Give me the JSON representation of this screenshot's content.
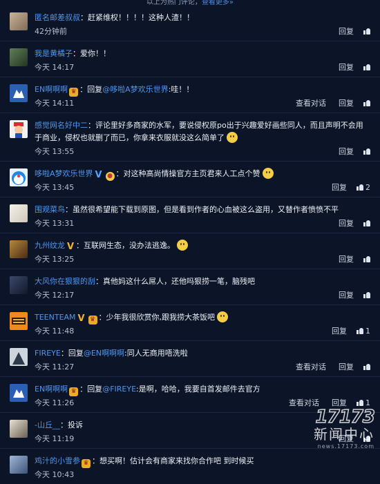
{
  "top_note": {
    "prefix": "以上为热门评论，",
    "link": "查看更多»"
  },
  "actions": {
    "reply": "回复",
    "view_conversation": "查看对话"
  },
  "comments": [
    {
      "user": "匿名邮差叔叔",
      "sep": "：",
      "text": "赶紧维权！！！！这种人渣！！",
      "time": "42分钟前",
      "likes": "",
      "conv": false
    },
    {
      "user": "我是黄橘子",
      "sep": "：",
      "text": "爱你！！",
      "time": "今天 14:17",
      "likes": "",
      "conv": false
    },
    {
      "user": "EN啊啊啊",
      "sep": "：",
      "reply_prefix": "回复",
      "reply_to": "@哆啦A梦欢乐世界",
      "text": ":哇！！",
      "time": "今天 14:11",
      "likes": "",
      "conv": true
    },
    {
      "user": "感觉网名好中二",
      "sep": "：",
      "text": "评论里好多商家的水军，要说侵权原po出于兴趣爱好画些同人，而且声明不会用于商业，侵权也就删了而已，你拿来衣服就没这么简单了",
      "time": "今天 13:55",
      "likes": "",
      "conv": false
    },
    {
      "user": "哆啦A梦欢乐世界",
      "sep": "：",
      "text": "对这种高尚情操官方主页君来人工点个赞",
      "time": "今天 13:45",
      "likes": "2",
      "conv": false
    },
    {
      "user": "围观菜鸟",
      "sep": "：",
      "text": "虽然很希望能下载到原图，但是看到作者的心血被这么盗用，又替作者愤愤不平",
      "time": "今天 13:31",
      "likes": "",
      "conv": false
    },
    {
      "user": "九州纹龙",
      "sep": "：",
      "text": "互联网生态，没办法逃逸。",
      "time": "今天 13:25",
      "likes": "",
      "conv": false
    },
    {
      "user": "大风你在狠狠的刮",
      "sep": "：",
      "text": "真他妈这什么屌人，还他吗狠捞一笔，脑残吧",
      "time": "今天 12:17",
      "likes": "",
      "conv": false
    },
    {
      "user": "TEENTEAM",
      "sep": "：",
      "text": "少年我很欣赏你,跟我捞大茶饭吧",
      "time": "今天 11:48",
      "likes": "1",
      "conv": false
    },
    {
      "user": "FIREYE",
      "sep": "：",
      "reply_prefix": "回复",
      "reply_to": "@EN啊啊啊",
      "text": ":同人无商用唔洗啦",
      "time": "今天 11:27",
      "likes": "",
      "conv": true
    },
    {
      "user": "EN啊啊啊",
      "sep": "：",
      "reply_prefix": "回复",
      "reply_to": "@FIREYE",
      "text": ":是啊，哈哈，我要自首发邮件去官方",
      "time": "今天 11:26",
      "likes": "1",
      "conv": true
    },
    {
      "user": "-山丘__",
      "sep": "：",
      "text": "投诉",
      "time": "今天 11:19",
      "likes": "",
      "conv": false
    },
    {
      "user": "鸡汁的小雪参",
      "sep": "：",
      "text": "想买啊！估计会有商家来找你合作吧 到时候买",
      "time": "今天 10:43",
      "likes": "",
      "conv": false
    }
  ],
  "watermark": {
    "logo": "17173",
    "cn": "新闻中心",
    "url": "news.17173.com"
  },
  "colors": {
    "background": "#0c1527",
    "username": "#4e96f0",
    "text": "#ecf0f6"
  }
}
